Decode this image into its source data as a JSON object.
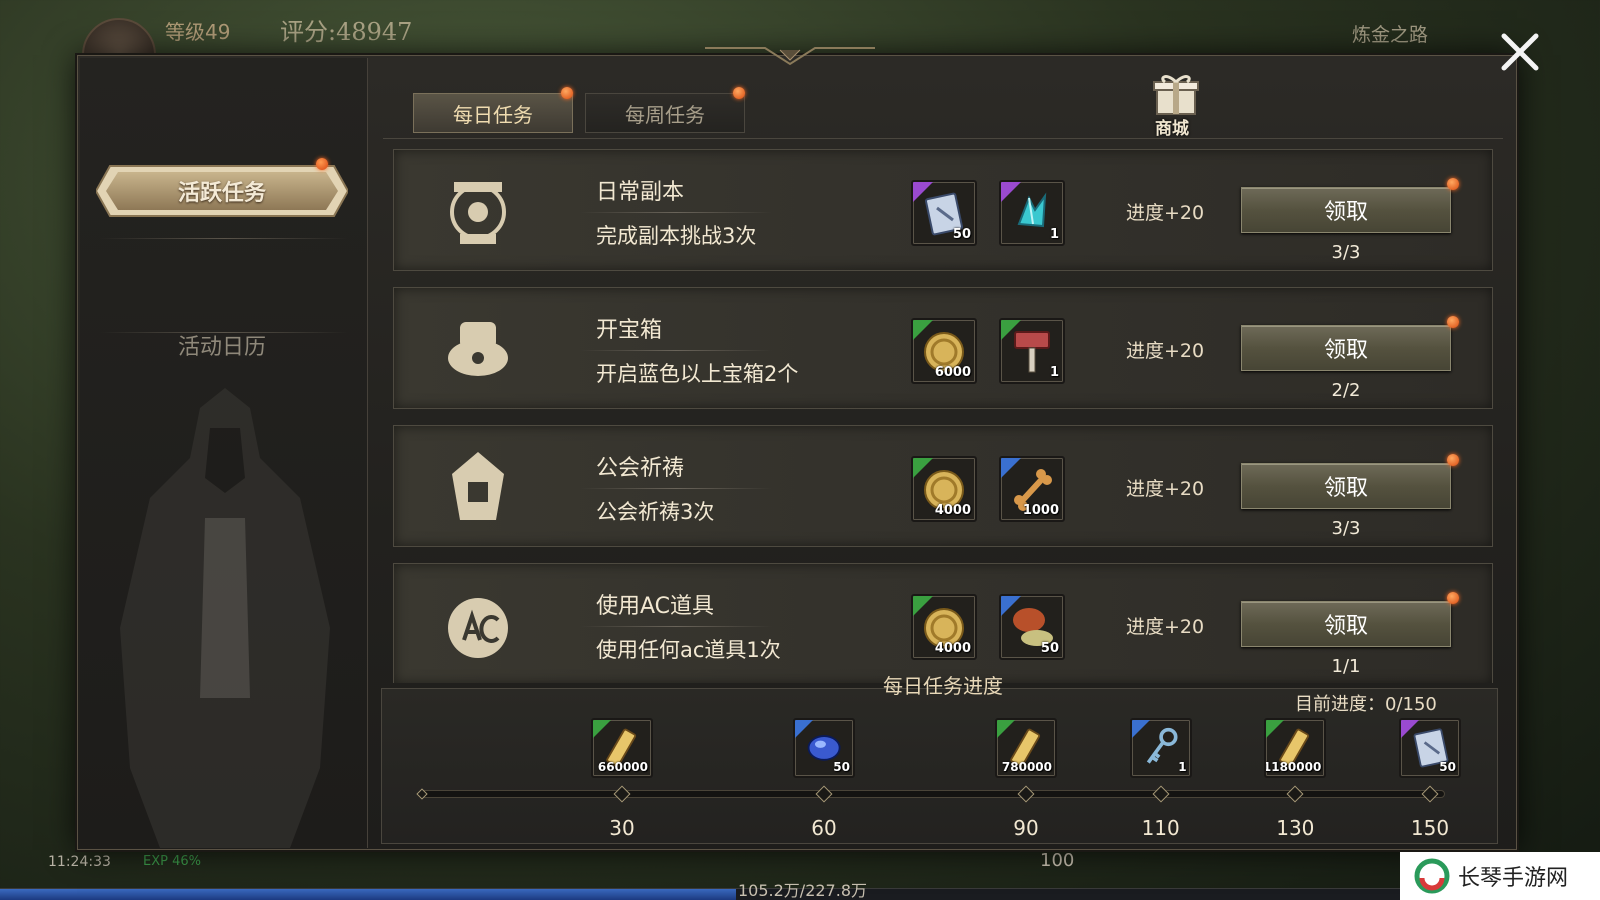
{
  "hud": {
    "level": "等级49",
    "score": "评分:48947",
    "route": "炼金之路",
    "clock": "11:24:33",
    "exp": "EXP 46%",
    "exp_progress": 0.46,
    "exp_text": "105.2万/227.8万",
    "hp": "100"
  },
  "sidebar": {
    "active_tab": "活跃任务",
    "tab2": "活动日历"
  },
  "tabs": {
    "daily": "每日任务",
    "weekly": "每周任务"
  },
  "shop_label": "商城",
  "tasks": [
    {
      "title": "日常副本",
      "desc": "完成副本挑战3次",
      "rewards": [
        {
          "icon": "scroll-card-icon",
          "qty": "50",
          "rarity": "#9a4ad0"
        },
        {
          "icon": "crystal-icon",
          "qty": "1",
          "rarity": "#9a4ad0"
        }
      ],
      "progress": "进度+20",
      "button": "领取",
      "count": "3/3"
    },
    {
      "title": "开宝箱",
      "desc": "开启蓝色以上宝箱2个",
      "rewards": [
        {
          "icon": "gold-coin-icon",
          "qty": "6000",
          "rarity": "#3aa040"
        },
        {
          "icon": "hammer-icon",
          "qty": "1",
          "rarity": "#3aa040"
        }
      ],
      "progress": "进度+20",
      "button": "领取",
      "count": "2/2"
    },
    {
      "title": "公会祈祷",
      "desc": "公会祈祷3次",
      "rewards": [
        {
          "icon": "gold-coin-icon",
          "qty": "4000",
          "rarity": "#3aa040"
        },
        {
          "icon": "bone-icon",
          "qty": "1000",
          "rarity": "#3a70d0"
        }
      ],
      "progress": "进度+20",
      "button": "领取",
      "count": "3/3"
    },
    {
      "title": "使用AC道具",
      "desc": "使用任何ac道具1次",
      "rewards": [
        {
          "icon": "gold-coin-icon",
          "qty": "4000",
          "rarity": "#3aa040"
        },
        {
          "icon": "mushroom-pile-icon",
          "qty": "50",
          "rarity": "#3a70d0"
        }
      ],
      "progress": "进度+20",
      "button": "领取",
      "count": "1/1"
    }
  ],
  "daily_progress": {
    "title": "每日任务进度",
    "current_label": "目前进度：0/150",
    "current": 0,
    "max": 150,
    "milestones": [
      {
        "value": "30",
        "qty": "660000",
        "icon": "gold-bar-icon",
        "rarity": "#3aa040"
      },
      {
        "value": "60",
        "qty": "50",
        "icon": "blue-gem-icon",
        "rarity": "#3a70d0"
      },
      {
        "value": "90",
        "qty": "780000",
        "icon": "gold-bar-icon",
        "rarity": "#3aa040"
      },
      {
        "value": "110",
        "qty": "1",
        "icon": "key-icon",
        "rarity": "#3a70d0"
      },
      {
        "value": "130",
        "qty": "1180000",
        "icon": "gold-bar-icon",
        "rarity": "#3aa040"
      },
      {
        "value": "150",
        "qty": "50",
        "icon": "scroll-card-icon",
        "rarity": "#9a4ad0"
      }
    ]
  },
  "watermark": "长琴手游网"
}
